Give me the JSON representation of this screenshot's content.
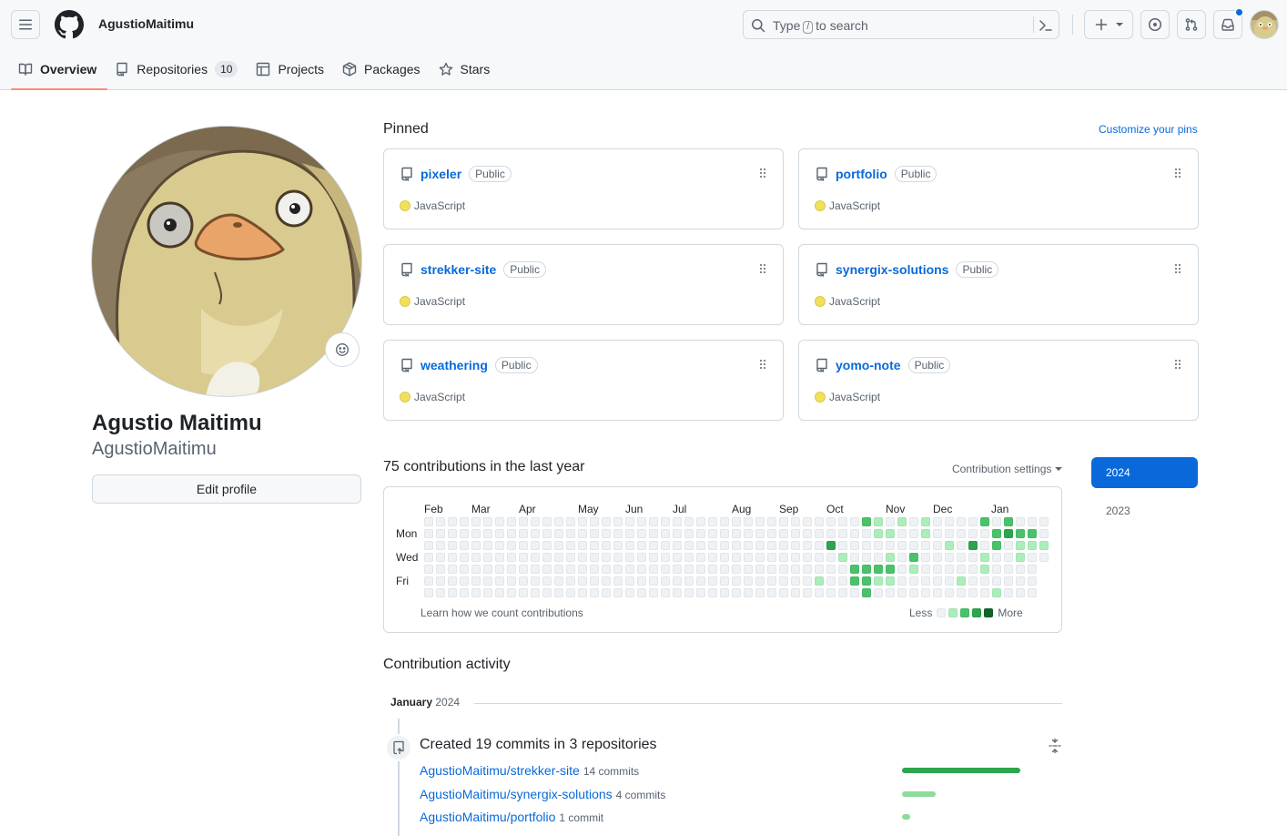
{
  "header": {
    "username": "AgustioMaitimu",
    "search": {
      "prefix": "Type",
      "slash": "/",
      "suffix": "to search"
    }
  },
  "tabs": [
    {
      "label": "Overview",
      "icon": "book-icon",
      "active": true
    },
    {
      "label": "Repositories",
      "icon": "repo-icon",
      "count": "10"
    },
    {
      "label": "Projects",
      "icon": "table-icon"
    },
    {
      "label": "Packages",
      "icon": "package-icon"
    },
    {
      "label": "Stars",
      "icon": "star-icon"
    }
  ],
  "profile": {
    "name": "Agustio Maitimu",
    "login": "AgustioMaitimu",
    "edit_label": "Edit profile"
  },
  "pinned": {
    "title": "Pinned",
    "customize_label": "Customize your pins",
    "repos": [
      {
        "name": "pixeler",
        "visibility": "Public",
        "language": "JavaScript"
      },
      {
        "name": "portfolio",
        "visibility": "Public",
        "language": "JavaScript"
      },
      {
        "name": "strekker-site",
        "visibility": "Public",
        "language": "JavaScript"
      },
      {
        "name": "synergix-solutions",
        "visibility": "Public",
        "language": "JavaScript"
      },
      {
        "name": "weathering",
        "visibility": "Public",
        "language": "JavaScript"
      },
      {
        "name": "yomo-note",
        "visibility": "Public",
        "language": "JavaScript"
      }
    ],
    "language_color": "#f1e05a"
  },
  "contributions": {
    "title": "75 contributions in the last year",
    "settings_label": "Contribution settings",
    "months": [
      "Feb",
      "Mar",
      "Apr",
      "May",
      "Jun",
      "Jul",
      "Aug",
      "Sep",
      "Oct",
      "Nov",
      "Dec",
      "Jan"
    ],
    "days": [
      "Mon",
      "Wed",
      "Fri"
    ],
    "learn_label": "Learn how we count contributions",
    "legend_less": "Less",
    "legend_more": "More",
    "level_colors": [
      "#eff2f5",
      "#aceebb",
      "#4ac26b",
      "#2da44e",
      "#116329"
    ],
    "weeks": 53,
    "active_days": [
      [
        34,
        5,
        1
      ],
      [
        35,
        2,
        3
      ],
      [
        36,
        3,
        1
      ],
      [
        37,
        4,
        2
      ],
      [
        37,
        5,
        2
      ],
      [
        38,
        0,
        2
      ],
      [
        38,
        4,
        2
      ],
      [
        38,
        5,
        2
      ],
      [
        38,
        6,
        2
      ],
      [
        39,
        4,
        2
      ],
      [
        39,
        5,
        1
      ],
      [
        39,
        0,
        1
      ],
      [
        39,
        1,
        1
      ],
      [
        40,
        3,
        1
      ],
      [
        40,
        4,
        2
      ],
      [
        40,
        5,
        1
      ],
      [
        40,
        1,
        1
      ],
      [
        41,
        0,
        1
      ],
      [
        42,
        3,
        2
      ],
      [
        42,
        4,
        1
      ],
      [
        43,
        0,
        1
      ],
      [
        43,
        1,
        1
      ],
      [
        45,
        2,
        1
      ],
      [
        46,
        5,
        1
      ],
      [
        47,
        2,
        3
      ],
      [
        48,
        0,
        2
      ],
      [
        48,
        4,
        1
      ],
      [
        48,
        3,
        1
      ],
      [
        49,
        1,
        2
      ],
      [
        49,
        2,
        2
      ],
      [
        49,
        6,
        1
      ],
      [
        50,
        0,
        2
      ],
      [
        50,
        1,
        3
      ],
      [
        51,
        1,
        2
      ],
      [
        52,
        1,
        2
      ],
      [
        51,
        2,
        1
      ],
      [
        51,
        3,
        1
      ],
      [
        52,
        2,
        1
      ],
      [
        53,
        2,
        1
      ]
    ],
    "years": [
      {
        "label": "2024",
        "active": true
      },
      {
        "label": "2023",
        "active": false
      }
    ]
  },
  "activity": {
    "title": "Contribution activity",
    "month": "January",
    "year": "2024",
    "commits_title": "Created 19 commits in 3 repositories",
    "repos": [
      {
        "name": "AgustioMaitimu/strekker-site",
        "count_label": "14 commits",
        "commits": 14,
        "color": "#2da44e"
      },
      {
        "name": "AgustioMaitimu/synergix-solutions",
        "count_label": "4 commits",
        "commits": 4,
        "color": "#8ddb9b"
      },
      {
        "name": "AgustioMaitimu/portfolio",
        "count_label": "1 commit",
        "commits": 1,
        "color": "#8ddb9b"
      }
    ]
  }
}
